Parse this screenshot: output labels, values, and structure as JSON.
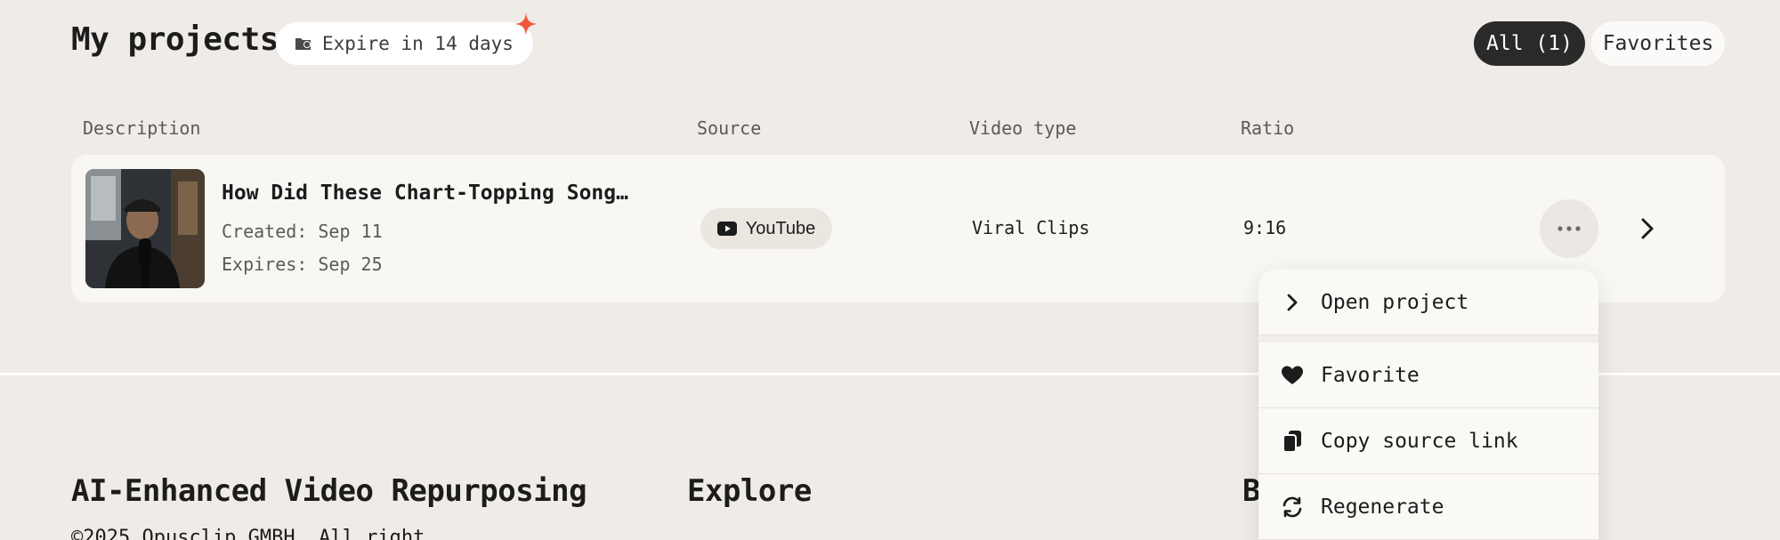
{
  "header": {
    "title": "My projects",
    "expire_label": "Expire in 14 days",
    "filters": {
      "all_label": "All (1)",
      "favorites_label": "Favorites"
    }
  },
  "table": {
    "columns": [
      "Description",
      "Source",
      "Video type",
      "Ratio"
    ],
    "rows": [
      {
        "title": "How Did These Chart-Topping Song…",
        "created": "Created: Sep 11",
        "expires": "Expires: Sep 25",
        "source": "YouTube",
        "video_type": "Viral Clips",
        "ratio": "9:16"
      }
    ]
  },
  "menu": {
    "items": [
      {
        "label": "Open project",
        "icon": "chevron-right-icon"
      },
      {
        "label": "Favorite",
        "icon": "heart-icon"
      },
      {
        "label": "Copy source link",
        "icon": "copy-icon"
      },
      {
        "label": "Regenerate",
        "icon": "refresh-icon"
      }
    ]
  },
  "footer": {
    "brand_heading": "AI-Enhanced Video Repurposing",
    "explore_heading": "Explore",
    "third_heading_partial": "B",
    "copyright_partial": "©2025 Opusclip GMBH. All right"
  },
  "colors": {
    "background": "#efebe6",
    "card": "#f8f7f4",
    "accent_sparkle": "#f0573b",
    "active_filter": "#2a2a2a"
  }
}
